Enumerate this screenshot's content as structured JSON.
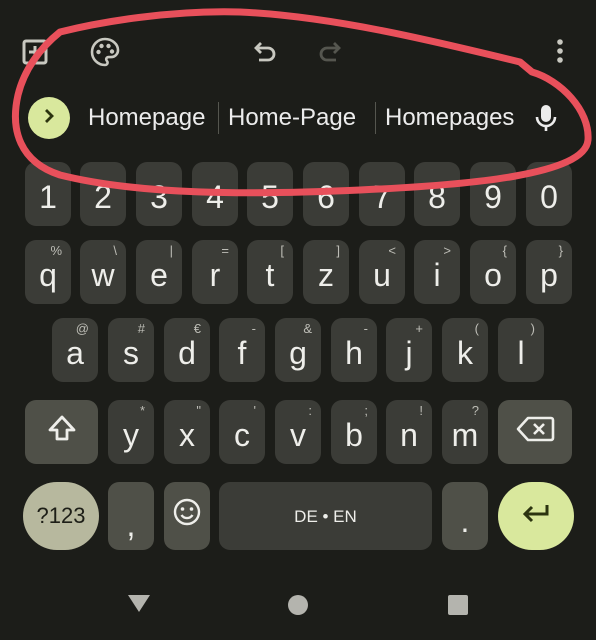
{
  "toolbar": {
    "icons": [
      "add-box-icon",
      "palette-icon",
      "undo-icon",
      "redo-icon",
      "more-vert-icon"
    ]
  },
  "suggestions": {
    "items": [
      "Homepage",
      "Home-Page",
      "Homepages"
    ],
    "expand_icon": "chevron-right-icon",
    "mic_icon": "mic-icon"
  },
  "keyboard": {
    "number_row": [
      "1",
      "2",
      "3",
      "4",
      "5",
      "6",
      "7",
      "8",
      "9",
      "0"
    ],
    "row1": [
      {
        "key": "q",
        "hint": "%"
      },
      {
        "key": "w",
        "hint": "\\"
      },
      {
        "key": "e",
        "hint": "|"
      },
      {
        "key": "r",
        "hint": "="
      },
      {
        "key": "t",
        "hint": "["
      },
      {
        "key": "z",
        "hint": "]"
      },
      {
        "key": "u",
        "hint": "<"
      },
      {
        "key": "i",
        "hint": ">"
      },
      {
        "key": "o",
        "hint": "{"
      },
      {
        "key": "p",
        "hint": "}"
      }
    ],
    "row2": [
      {
        "key": "a",
        "hint": "@"
      },
      {
        "key": "s",
        "hint": "#"
      },
      {
        "key": "d",
        "hint": "€"
      },
      {
        "key": "f",
        "hint": "-"
      },
      {
        "key": "g",
        "hint": "&"
      },
      {
        "key": "h",
        "hint": "-"
      },
      {
        "key": "j",
        "hint": "+"
      },
      {
        "key": "k",
        "hint": "("
      },
      {
        "key": "l",
        "hint": ")"
      }
    ],
    "row3": [
      {
        "key": "y",
        "hint": "*"
      },
      {
        "key": "x",
        "hint": "\""
      },
      {
        "key": "c",
        "hint": "'"
      },
      {
        "key": "v",
        "hint": ":"
      },
      {
        "key": "b",
        "hint": ";"
      },
      {
        "key": "n",
        "hint": "!"
      },
      {
        "key": "m",
        "hint": "?"
      }
    ],
    "shift_icon": "shift-icon",
    "backspace_icon": "backspace-icon",
    "symbols_label": "?123",
    "comma_label": ",",
    "emoji_icon": "emoji-icon",
    "space_label": "DE • EN",
    "period_label": ".",
    "enter_icon": "enter-icon"
  },
  "navbar": {
    "icons": [
      "back-icon",
      "home-icon",
      "recents-icon"
    ]
  },
  "colors": {
    "background": "#1c1d19",
    "key": "#3b3c37",
    "special_key": "#4f5048",
    "accent": "#d9e89d",
    "symbols_key": "#b7b89e",
    "annotation": "#e8505b"
  }
}
